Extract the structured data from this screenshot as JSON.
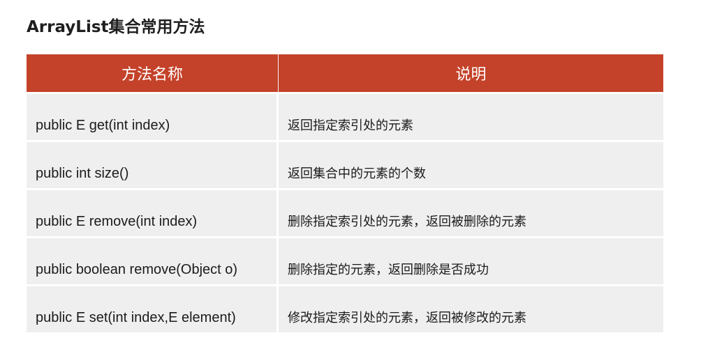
{
  "page": {
    "title": "ArrayList集合常用方法"
  },
  "table": {
    "headers": [
      "方法名称",
      "说明"
    ],
    "rows": [
      {
        "method": "public E get(int index)",
        "description": "返回指定索引处的元素"
      },
      {
        "method": "public int size()",
        "description": "返回集合中的元素的个数"
      },
      {
        "method": "public E remove(int index)",
        "description": "删除指定索引处的元素，返回被删除的元素"
      },
      {
        "method": "public boolean remove(Object o)",
        "description": "删除指定的元素，返回删除是否成功"
      },
      {
        "method": "public E set(int index,E element)",
        "description": "修改指定索引处的元素，返回被修改的元素"
      }
    ]
  },
  "colors": {
    "header_background": "#c4422a",
    "header_text": "#ffffff",
    "row_background": "#efefef"
  }
}
